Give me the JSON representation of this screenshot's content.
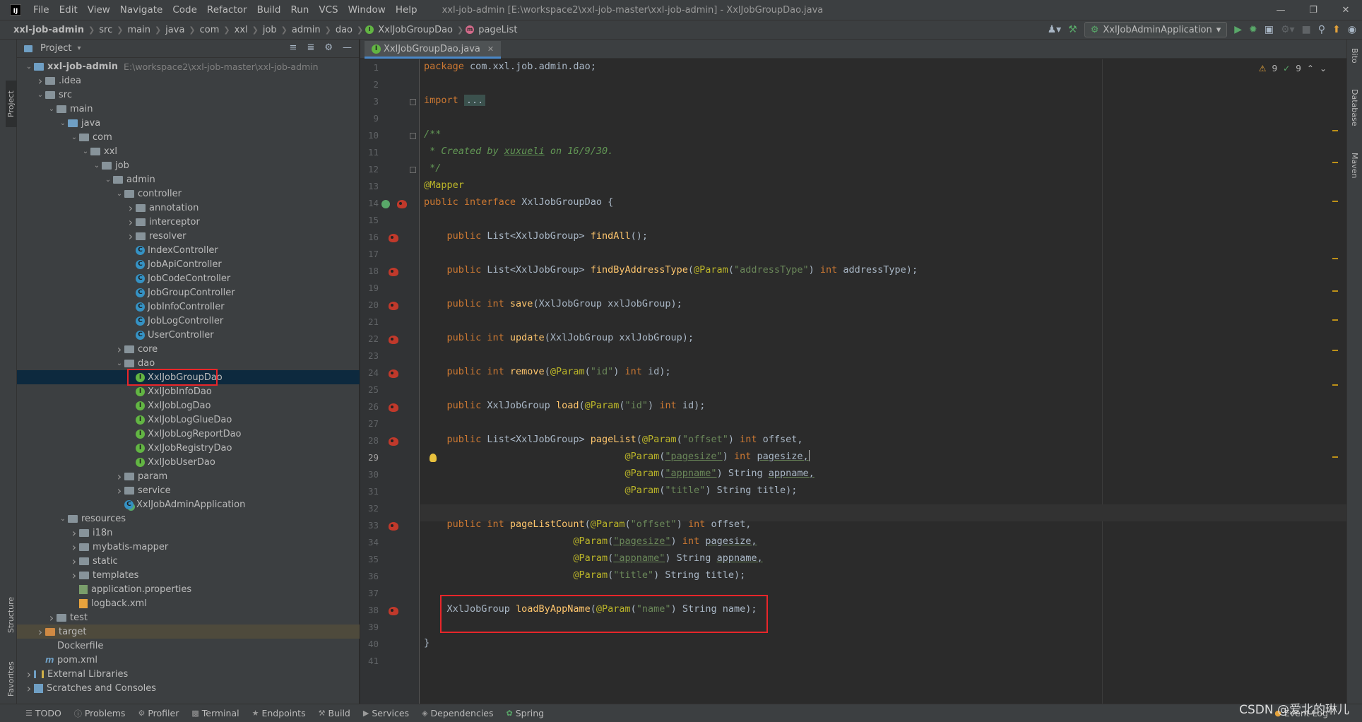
{
  "menubar": {
    "logo": "IJ",
    "items": [
      "File",
      "Edit",
      "View",
      "Navigate",
      "Code",
      "Refactor",
      "Build",
      "Run",
      "VCS",
      "Window",
      "Help"
    ],
    "window_title": "xxl-job-admin [E:\\workspace2\\xxl-job-master\\xxl-job-admin] - XxlJobGroupDao.java"
  },
  "breadcrumb": {
    "items": [
      "xxl-job-admin",
      "src",
      "main",
      "java",
      "com",
      "xxl",
      "job",
      "admin",
      "dao",
      "XxlJobGroupDao",
      "pageList"
    ]
  },
  "toolbar": {
    "run_config": "XxlJobAdminApplication"
  },
  "left_stripe": {
    "project": "Project",
    "structure": "Structure",
    "favorites": "Favorites"
  },
  "right_stripe": {
    "bito": "Bito",
    "database": "Database",
    "maven": "Maven"
  },
  "project_panel": {
    "title": "Project",
    "tree": [
      {
        "label": "xxl-job-admin",
        "hint": "E:\\workspace2\\xxl-job-master\\xxl-job-admin",
        "depth": 0,
        "kind": "module",
        "expanded": true
      },
      {
        "label": ".idea",
        "depth": 1,
        "kind": "folder",
        "expanded": false
      },
      {
        "label": "src",
        "depth": 1,
        "kind": "folder",
        "expanded": true
      },
      {
        "label": "main",
        "depth": 2,
        "kind": "folder",
        "expanded": true
      },
      {
        "label": "java",
        "depth": 3,
        "kind": "src",
        "expanded": true
      },
      {
        "label": "com",
        "depth": 4,
        "kind": "folder",
        "expanded": true
      },
      {
        "label": "xxl",
        "depth": 5,
        "kind": "folder",
        "expanded": true
      },
      {
        "label": "job",
        "depth": 6,
        "kind": "folder",
        "expanded": true
      },
      {
        "label": "admin",
        "depth": 7,
        "kind": "folder",
        "expanded": true
      },
      {
        "label": "controller",
        "depth": 8,
        "kind": "folder",
        "expanded": true
      },
      {
        "label": "annotation",
        "depth": 9,
        "kind": "folder",
        "expanded": false
      },
      {
        "label": "interceptor",
        "depth": 9,
        "kind": "folder",
        "expanded": false
      },
      {
        "label": "resolver",
        "depth": 9,
        "kind": "folder",
        "expanded": false
      },
      {
        "label": "IndexController",
        "depth": 9,
        "kind": "class"
      },
      {
        "label": "JobApiController",
        "depth": 9,
        "kind": "class"
      },
      {
        "label": "JobCodeController",
        "depth": 9,
        "kind": "class"
      },
      {
        "label": "JobGroupController",
        "depth": 9,
        "kind": "class"
      },
      {
        "label": "JobInfoController",
        "depth": 9,
        "kind": "class"
      },
      {
        "label": "JobLogController",
        "depth": 9,
        "kind": "class"
      },
      {
        "label": "UserController",
        "depth": 9,
        "kind": "class"
      },
      {
        "label": "core",
        "depth": 8,
        "kind": "folder",
        "expanded": false
      },
      {
        "label": "dao",
        "depth": 8,
        "kind": "folder",
        "expanded": true
      },
      {
        "label": "XxlJobGroupDao",
        "depth": 9,
        "kind": "interface",
        "selected": true
      },
      {
        "label": "XxlJobInfoDao",
        "depth": 9,
        "kind": "interface"
      },
      {
        "label": "XxlJobLogDao",
        "depth": 9,
        "kind": "interface"
      },
      {
        "label": "XxlJobLogGlueDao",
        "depth": 9,
        "kind": "interface"
      },
      {
        "label": "XxlJobLogReportDao",
        "depth": 9,
        "kind": "interface"
      },
      {
        "label": "XxlJobRegistryDao",
        "depth": 9,
        "kind": "interface"
      },
      {
        "label": "XxlJobUserDao",
        "depth": 9,
        "kind": "interface"
      },
      {
        "label": "param",
        "depth": 8,
        "kind": "folder",
        "expanded": false
      },
      {
        "label": "service",
        "depth": 8,
        "kind": "folder",
        "expanded": false
      },
      {
        "label": "XxlJobAdminApplication",
        "depth": 8,
        "kind": "app"
      },
      {
        "label": "resources",
        "depth": 3,
        "kind": "folder",
        "expanded": true
      },
      {
        "label": "i18n",
        "depth": 4,
        "kind": "folder",
        "expanded": false
      },
      {
        "label": "mybatis-mapper",
        "depth": 4,
        "kind": "folder",
        "expanded": false
      },
      {
        "label": "static",
        "depth": 4,
        "kind": "folder",
        "expanded": false
      },
      {
        "label": "templates",
        "depth": 4,
        "kind": "folder",
        "expanded": false
      },
      {
        "label": "application.properties",
        "depth": 4,
        "kind": "props"
      },
      {
        "label": "logback.xml",
        "depth": 4,
        "kind": "xml"
      },
      {
        "label": "test",
        "depth": 2,
        "kind": "folder",
        "expanded": false
      },
      {
        "label": "target",
        "depth": 1,
        "kind": "target",
        "expanded": false
      },
      {
        "label": "Dockerfile",
        "depth": 1,
        "kind": "file"
      },
      {
        "label": "pom.xml",
        "depth": 1,
        "kind": "maven"
      },
      {
        "label": "External Libraries",
        "depth": 0,
        "kind": "lib",
        "expanded": false
      },
      {
        "label": "Scratches and Consoles",
        "depth": 0,
        "kind": "scratch",
        "expanded": false
      }
    ]
  },
  "editor": {
    "tab_label": "XxlJobGroupDao.java",
    "inspection": {
      "warnings": "9",
      "weak": "9"
    },
    "lines": [
      {
        "n": "1"
      },
      {
        "n": "2"
      },
      {
        "n": "3"
      },
      {
        "n": "9"
      },
      {
        "n": "10"
      },
      {
        "n": "11"
      },
      {
        "n": "12"
      },
      {
        "n": "13"
      },
      {
        "n": "14"
      },
      {
        "n": "15"
      },
      {
        "n": "16"
      },
      {
        "n": "17"
      },
      {
        "n": "18"
      },
      {
        "n": "19"
      },
      {
        "n": "20"
      },
      {
        "n": "21"
      },
      {
        "n": "22"
      },
      {
        "n": "23"
      },
      {
        "n": "24"
      },
      {
        "n": "25"
      },
      {
        "n": "26"
      },
      {
        "n": "27"
      },
      {
        "n": "28"
      },
      {
        "n": "29"
      },
      {
        "n": "30"
      },
      {
        "n": "31"
      },
      {
        "n": "32"
      },
      {
        "n": "33"
      },
      {
        "n": "34"
      },
      {
        "n": "35"
      },
      {
        "n": "36"
      },
      {
        "n": "37"
      },
      {
        "n": "38"
      },
      {
        "n": "39"
      },
      {
        "n": "40"
      },
      {
        "n": "41"
      }
    ],
    "code": {
      "l1a": "package ",
      "l1b": "com.xxl.job.admin.dao;",
      "l3a": "import ",
      "l3b": "...",
      "l10": "/**",
      "l11a": " * Created by ",
      "l11b": "xuxueli",
      "l11c": " on 16/9/30.",
      "l12": " */",
      "l13": "@Mapper",
      "l14a": "public ",
      "l14b": "interface ",
      "l14c": "XxlJobGroupDao {",
      "l16a": "    public ",
      "l16b": "List<XxlJobGroup> ",
      "l16c": "findAll",
      "l16d": "();",
      "l18a": "    public ",
      "l18b": "List<XxlJobGroup> ",
      "l18c": "findByAddressType",
      "l18d": "(",
      "l18e": "@Param",
      "l18f": "(",
      "l18g": "\"addressType\"",
      "l18h": ") ",
      "l18i": "int ",
      "l18j": "addressType);",
      "l20a": "    public ",
      "l20b": "int ",
      "l20c": "save",
      "l20d": "(XxlJobGroup xxlJobGroup);",
      "l22a": "    public ",
      "l22b": "int ",
      "l22c": "update",
      "l22d": "(XxlJobGroup xxlJobGroup);",
      "l24a": "    public ",
      "l24b": "int ",
      "l24c": "remove",
      "l24d": "(",
      "l24e": "@Param",
      "l24f": "(",
      "l24g": "\"id\"",
      "l24h": ") ",
      "l24i": "int ",
      "l24j": "id);",
      "l26a": "    public ",
      "l26b": "XxlJobGroup ",
      "l26c": "load",
      "l26d": "(",
      "l26e": "@Param",
      "l26f": "(",
      "l26g": "\"id\"",
      "l26h": ") ",
      "l26i": "int ",
      "l26j": "id);",
      "l28a": "    public ",
      "l28b": "List<XxlJobGroup> ",
      "l28c": "pageList",
      "l28d": "(",
      "l28e": "@Param",
      "l28f": "(",
      "l28g": "\"offset\"",
      "l28h": ") ",
      "l28i": "int ",
      "l28j": "offset,",
      "l29pad": "                                   ",
      "l29e": "@Param",
      "l29f": "(",
      "l29g": "\"pagesize\"",
      "l29h": ") ",
      "l29i": "int ",
      "l29j": "pagesize,",
      "l30pad": "                                   ",
      "l30e": "@Param",
      "l30f": "(",
      "l30g": "\"appname\"",
      "l30h": ") String ",
      "l30j": "appname,",
      "l31pad": "                                   ",
      "l31e": "@Param",
      "l31f": "(",
      "l31g": "\"title\"",
      "l31h": ") String title);",
      "l33a": "    public ",
      "l33b": "int ",
      "l33c": "pageListCount",
      "l33d": "(",
      "l33e": "@Param",
      "l33f": "(",
      "l33g": "\"offset\"",
      "l33h": ") ",
      "l33i": "int ",
      "l33j": "offset,",
      "l34pad": "                          ",
      "l34e": "@Param",
      "l34f": "(",
      "l34g": "\"pagesize\"",
      "l34h": ") ",
      "l34i": "int ",
      "l34j": "pagesize,",
      "l35pad": "                          ",
      "l35e": "@Param",
      "l35f": "(",
      "l35g": "\"appname\"",
      "l35h": ") String ",
      "l35j": "appname,",
      "l36pad": "                          ",
      "l36e": "@Param",
      "l36f": "(",
      "l36g": "\"title\"",
      "l36h": ") String title);",
      "l38a": "    XxlJobGroup ",
      "l38b": "loadByAppName",
      "l38c": "(",
      "l38d": "@Param",
      "l38e": "(",
      "l38f": "\"name\"",
      "l38g": ") String name);",
      "l40": "}"
    }
  },
  "bottom_bar": {
    "items": [
      "TODO",
      "Problems",
      "Profiler",
      "Terminal",
      "Endpoints",
      "Build",
      "Services",
      "Dependencies",
      "Spring"
    ],
    "event_log": "Event Log"
  },
  "watermark": "CSDN @爱北的琳儿",
  "colors": {
    "background": "#2b2b2b",
    "panel": "#3c3f41",
    "selection": "#0d293e",
    "keyword": "#cc7832",
    "annotation": "#bbb529",
    "string": "#6a8759",
    "method": "#ffc66d",
    "highlight_box": "#e8262a"
  }
}
